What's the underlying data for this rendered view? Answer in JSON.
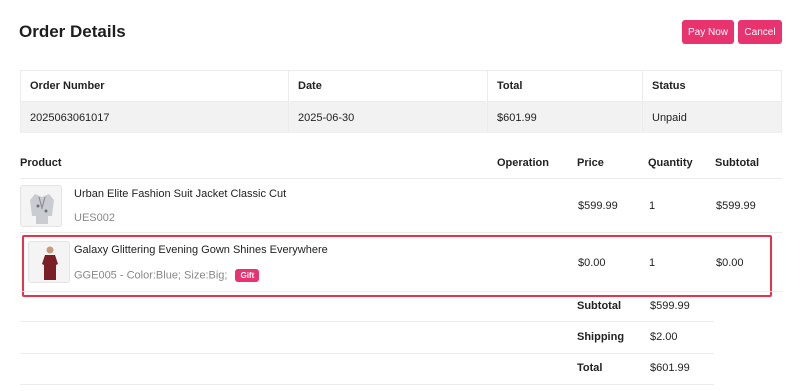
{
  "header": {
    "title": "Order Details",
    "pay_label": "Pay Now",
    "cancel_label": "Cancel"
  },
  "colors": {
    "accent": "#e8336f",
    "highlight_border": "#e8334a"
  },
  "summary": {
    "headers": [
      "Order Number",
      "Date",
      "Total",
      "Status"
    ],
    "values": [
      "2025063061017",
      "2025-06-30",
      "$601.99",
      "Unpaid"
    ]
  },
  "products": {
    "headers": [
      "Product",
      "Operation",
      "Price",
      "Quantity",
      "Subtotal"
    ],
    "items": [
      {
        "name": "Urban Elite Fashion Suit Jacket Classic Cut",
        "sku": "UES002",
        "price": "$599.99",
        "quantity": "1",
        "subtotal": "$599.99",
        "image_icon": "jacket-image"
      },
      {
        "name": "Galaxy Glittering Evening Gown Shines Everywhere",
        "sku": "GGE005 - Color:Blue; Size:Big;",
        "badge": "Gift",
        "price": "$0.00",
        "quantity": "1",
        "subtotal": "$0.00",
        "image_icon": "gown-image"
      }
    ]
  },
  "totals": [
    {
      "label": "Subtotal",
      "value": "$599.99"
    },
    {
      "label": "Shipping",
      "value": "$2.00"
    },
    {
      "label": "Total",
      "value": "$601.99"
    }
  ]
}
